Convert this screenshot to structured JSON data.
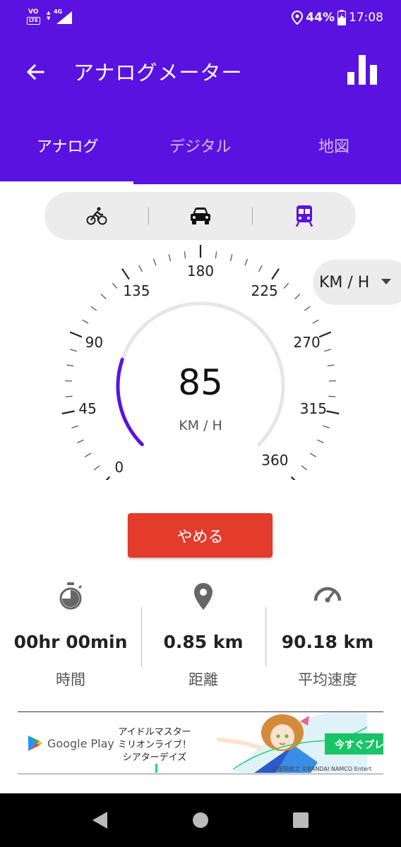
{
  "status_bar": {
    "volte_top": "VO",
    "volte_bottom": "LTE",
    "network": "4G",
    "battery": "44%",
    "time": "17:08"
  },
  "app_bar": {
    "title": "アナログメーター"
  },
  "tabs": [
    {
      "label": "アナログ",
      "active": true
    },
    {
      "label": "デジタル",
      "active": false
    },
    {
      "label": "地図",
      "active": false
    }
  ],
  "modes": [
    "bicycle-icon",
    "car-icon",
    "train-icon"
  ],
  "gauge": {
    "speed": "85",
    "unit": "KM / H",
    "min": 0,
    "max": 360,
    "arc_fraction": 0.236,
    "tick_labels": [
      "0",
      "45",
      "90",
      "135",
      "180",
      "225",
      "270",
      "315",
      "360"
    ]
  },
  "unit_selector": {
    "value": "KM / H"
  },
  "stop_button": "やめる",
  "stats": [
    {
      "icon": "stopwatch-icon",
      "value": "00hr 00min",
      "label": "時間"
    },
    {
      "icon": "location-pin-icon",
      "value": "0.85 km",
      "label": "距離"
    },
    {
      "icon": "speedometer-icon",
      "value": "90.18 km",
      "label": "平均速度"
    }
  ],
  "ad": {
    "store": "Google Play",
    "line1": "アイドルマスター",
    "line2": "ミリオンライブ！",
    "line3": "シアターデイズ",
    "cta": "今すぐプレ",
    "copyright": "©窪岡俊之 ©BANDAI NAMCO Entert"
  },
  "colors": {
    "primary": "#5a12e0",
    "accent_arc": "#5a12e0",
    "stop_button": "#e33b2c",
    "track": "#e6e6e6"
  }
}
